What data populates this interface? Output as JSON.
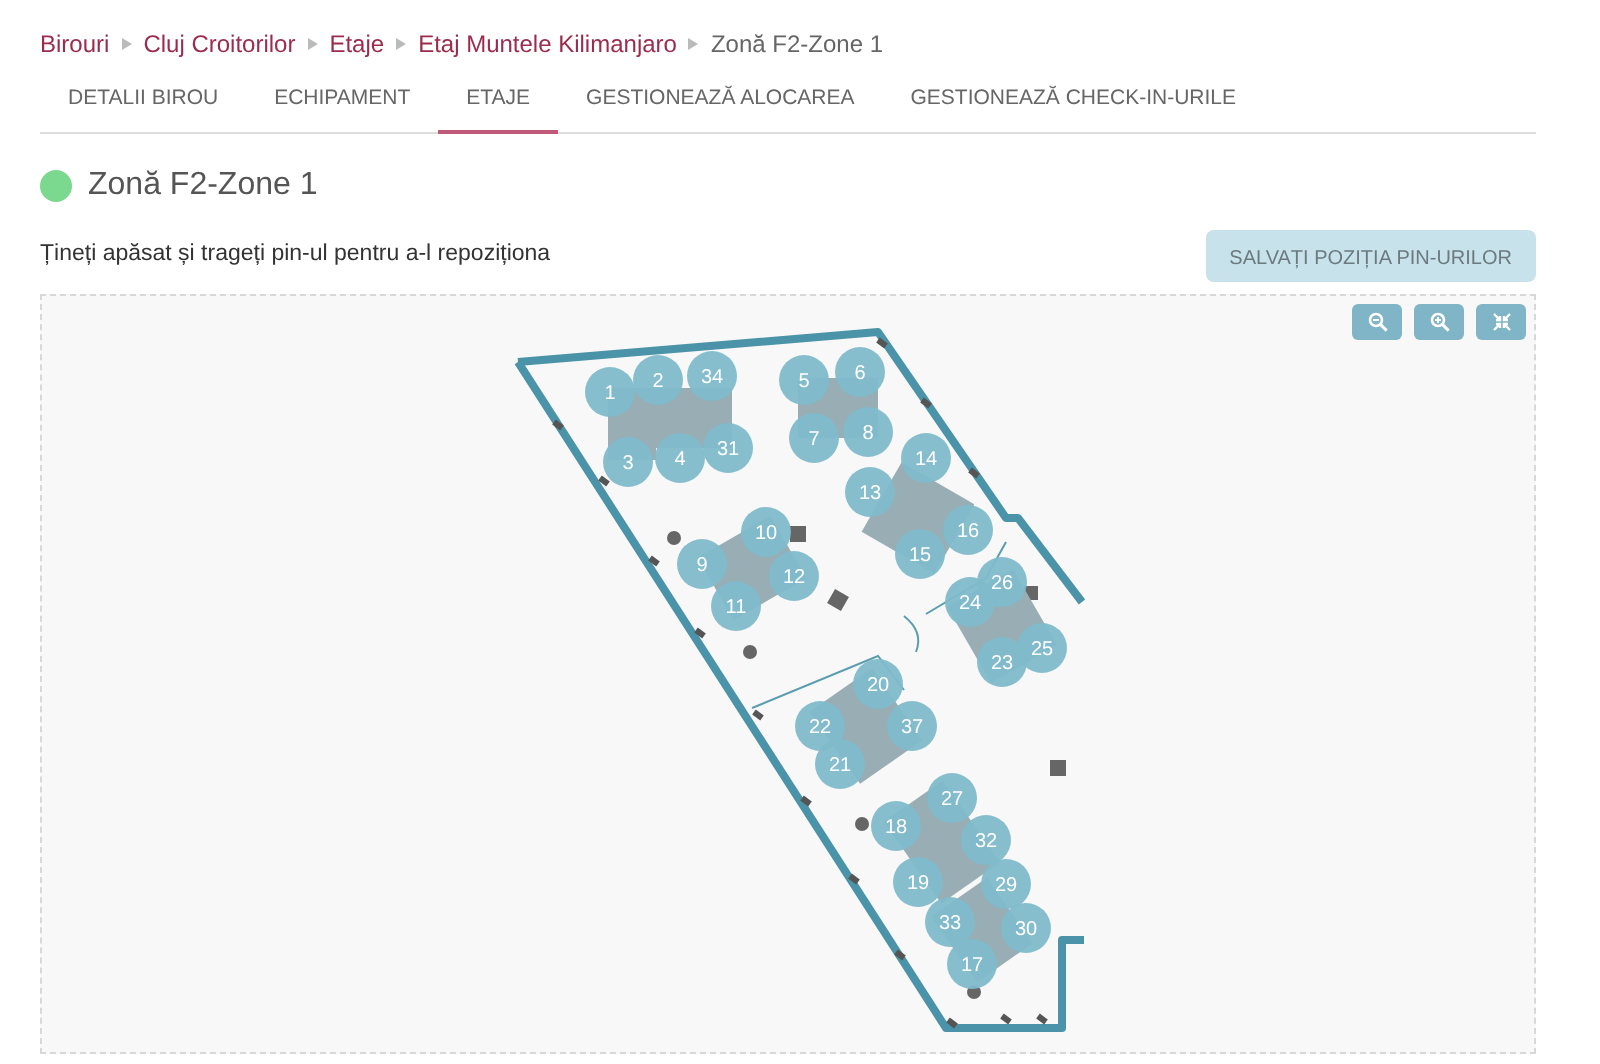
{
  "breadcrumb": [
    {
      "label": "Birouri",
      "link": true
    },
    {
      "label": "Cluj Croitorilor",
      "link": true
    },
    {
      "label": "Etaje",
      "link": true
    },
    {
      "label": "Etaj Muntele Kilimanjaro",
      "link": true
    },
    {
      "label": "Zonă F2-Zone 1",
      "link": false
    }
  ],
  "tabs": [
    {
      "label": "DETALII BIROU",
      "selected": false
    },
    {
      "label": "ECHIPAMENT",
      "selected": false
    },
    {
      "label": "ETAJE",
      "selected": true
    },
    {
      "label": "GESTIONEAZĂ ALOCAREA",
      "selected": false
    },
    {
      "label": "GESTIONEAZĂ CHECK-IN-URILE",
      "selected": false
    }
  ],
  "zone": {
    "title": "Zonă F2-Zone 1",
    "color": "#7bd88f"
  },
  "instruction": "Țineți apăsat și trageți pin-ul pentru a-l repoziționa",
  "save_button": {
    "label": "SALVAȚI POZIȚIA PIN-URILOR",
    "disabled": true
  },
  "pins": [
    {
      "label": "1"
    },
    {
      "label": "2"
    },
    {
      "label": "34"
    },
    {
      "label": "3"
    },
    {
      "label": "4"
    },
    {
      "label": "31"
    },
    {
      "label": "5"
    },
    {
      "label": "6"
    },
    {
      "label": "7"
    },
    {
      "label": "8"
    },
    {
      "label": "14"
    },
    {
      "label": "13"
    },
    {
      "label": "16"
    },
    {
      "label": "15"
    },
    {
      "label": "10"
    },
    {
      "label": "9"
    },
    {
      "label": "12"
    },
    {
      "label": "11"
    },
    {
      "label": "26"
    },
    {
      "label": "24"
    },
    {
      "label": "25"
    },
    {
      "label": "23"
    },
    {
      "label": "20"
    },
    {
      "label": "22"
    },
    {
      "label": "37"
    },
    {
      "label": "21"
    },
    {
      "label": "27"
    },
    {
      "label": "18"
    },
    {
      "label": "32"
    },
    {
      "label": "19"
    },
    {
      "label": "29"
    },
    {
      "label": "33"
    },
    {
      "label": "30"
    },
    {
      "label": "17"
    }
  ]
}
